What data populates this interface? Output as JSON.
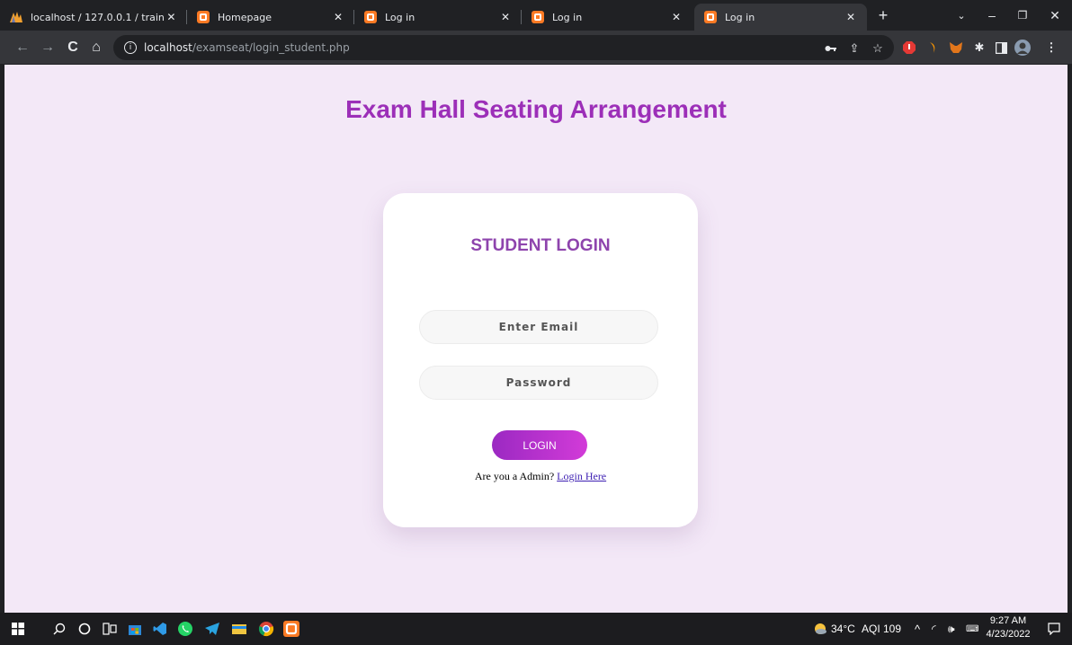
{
  "browser": {
    "tabs": [
      {
        "title": "localhost / 127.0.0.1 / train | ",
        "favicon": "phpmyadmin-icon"
      },
      {
        "title": "Homepage",
        "favicon": "xampp-icon"
      },
      {
        "title": "Log in",
        "favicon": "xampp-icon"
      },
      {
        "title": "Log in",
        "favicon": "xampp-icon"
      },
      {
        "title": "Log in",
        "favicon": "xampp-icon",
        "active": true
      }
    ],
    "url_host": "localhost",
    "url_path": "/examseat/login_student.php",
    "extension_icons": [
      "key-icon",
      "share-icon",
      "star-icon",
      "adblock-icon",
      "extension-orange-icon",
      "metamask-icon",
      "puzzle-icon",
      "sidepanel-icon",
      "profile-avatar-icon",
      "menu-icon"
    ]
  },
  "page": {
    "heading": "Exam Hall Seating Arrangement",
    "card_title": "STUDENT LOGIN",
    "email_placeholder": "Enter Email",
    "password_placeholder": "Password",
    "login_label": "LOGIN",
    "admin_prompt": "Are you a Admin?",
    "admin_link": "Login Here"
  },
  "taskbar": {
    "weather": "34°C",
    "aqi": "AQI 109",
    "time": "9:27 AM",
    "date": "4/23/2022"
  },
  "colors": {
    "page_bg": "#f3e8f7",
    "heading": "#9c2fb8",
    "card_title": "#8e44ad",
    "button_gradient_start": "#9b29c2",
    "button_gradient_end": "#d23bd8"
  }
}
